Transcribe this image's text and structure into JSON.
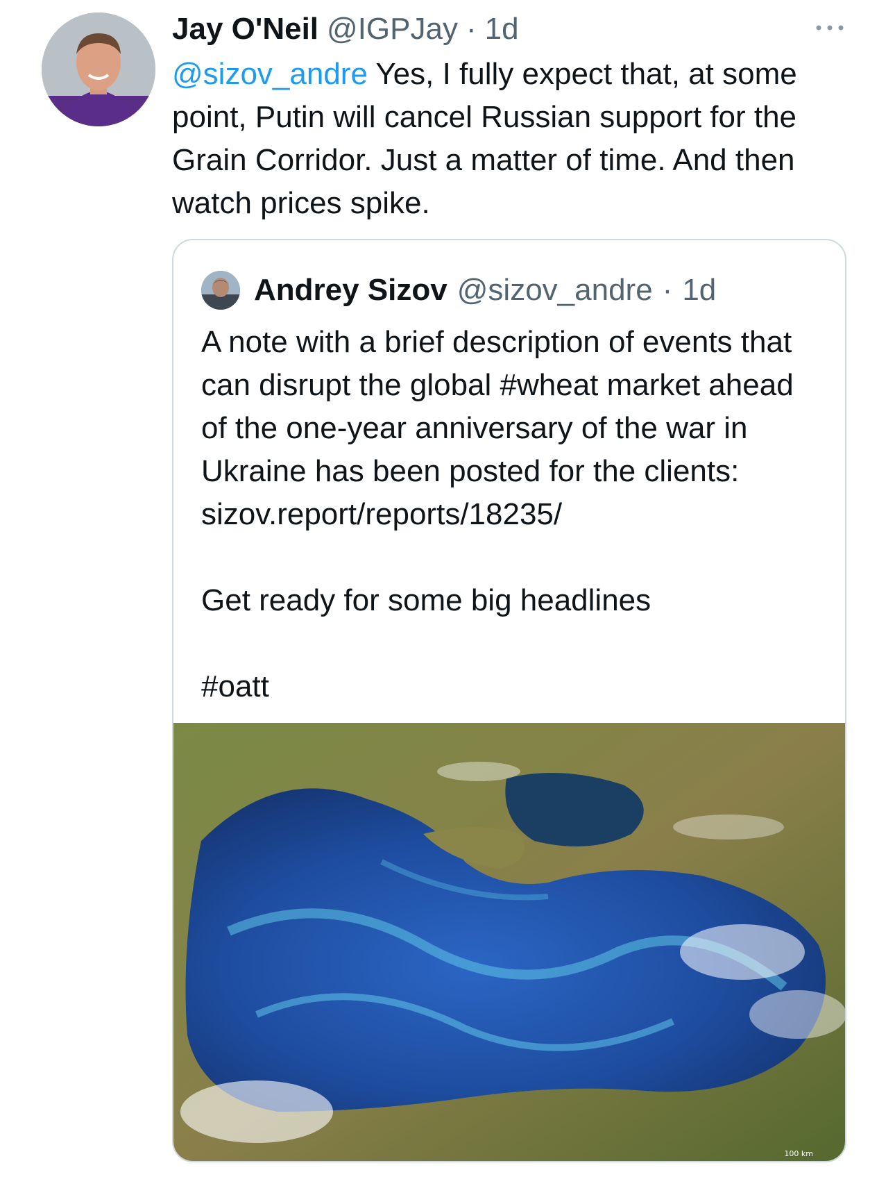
{
  "tweet": {
    "author_name": "Jay O'Neil",
    "author_handle": "@IGPJay",
    "separator": "·",
    "time": "1d",
    "mention": "@sizov_andre",
    "text": " Yes, I fully expect that, at some point, Putin will cancel Russian support for the Grain Corridor. Just a matter of time. And then watch prices spike.",
    "more_icon": "more-horizontal-icon"
  },
  "quote": {
    "author_name": "Andrey Sizov",
    "author_handle": "@sizov_andre",
    "separator": "·",
    "time": "1d",
    "paragraph_1": "A note with a brief description of events that can disrupt the global #wheat market ahead of the one-year anniversary of the war in Ukraine has been posted for the clients: sizov.report/reports/18235/",
    "paragraph_2": "Get ready for some big headlines",
    "paragraph_3": "#oatt",
    "media": {
      "scale_label": "100 km"
    }
  },
  "colors": {
    "link": "#1d9bf0",
    "secondary_text": "#536471",
    "border": "#cfd9de",
    "sea": "#1d4fa0",
    "land": "#6f7a3a"
  }
}
